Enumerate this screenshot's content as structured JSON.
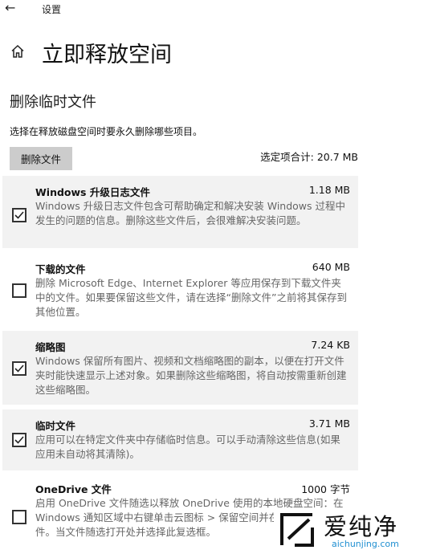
{
  "window": {
    "app_title": "设置"
  },
  "page": {
    "title": "立即释放空间",
    "section_title": "删除临时文件",
    "description": "选择在释放磁盘空间时要永久删除哪些项目。",
    "delete_button": "删除文件",
    "total_selected": "选定项合计: 20.7 MB"
  },
  "items": [
    {
      "name": "Windows 升级日志文件",
      "size": "1.18 MB",
      "checked": true,
      "description": "Windows 升级日志文件包含可帮助确定和解决安装 Windows 过程中发生的问题的信息。删除这些文件后，会很难解决安装问题。"
    },
    {
      "name": "下载的文件",
      "size": "640 MB",
      "checked": false,
      "description": "删除 Microsoft Edge、Internet Explorer 等应用保存到下载文件夹中的文件。如果要保留这些文件，请在选择“删除文件”之前将其保存到其他位置。"
    },
    {
      "name": "缩略图",
      "size": "7.24 KB",
      "checked": true,
      "description": "Windows 保留所有图片、视频和文档缩略图的副本，以便在打开文件夹时能快速显示上述对象。如果删除这些缩略图，将自动按需重新创建这些缩略图。"
    },
    {
      "name": "临时文件",
      "size": "3.71 MB",
      "checked": true,
      "description": "应用可以在特定文件夹中存储临时信息。可以手动清除这些信息(如果应用未自动将其清除)。"
    },
    {
      "name": "OneDrive 文件",
      "size": "1000 字节",
      "checked": false,
      "description": "启用 OneDrive 文件随选以释放 OneDrive 使用的本地硬盘空间：在 Windows 通知区域中右键单击云图标 > 保留空间并在使用时下载文件。当文件随选打开处并选择此复选框。"
    }
  ],
  "watermark": {
    "brand": "爱纯净",
    "url": "aichunjing.com"
  }
}
